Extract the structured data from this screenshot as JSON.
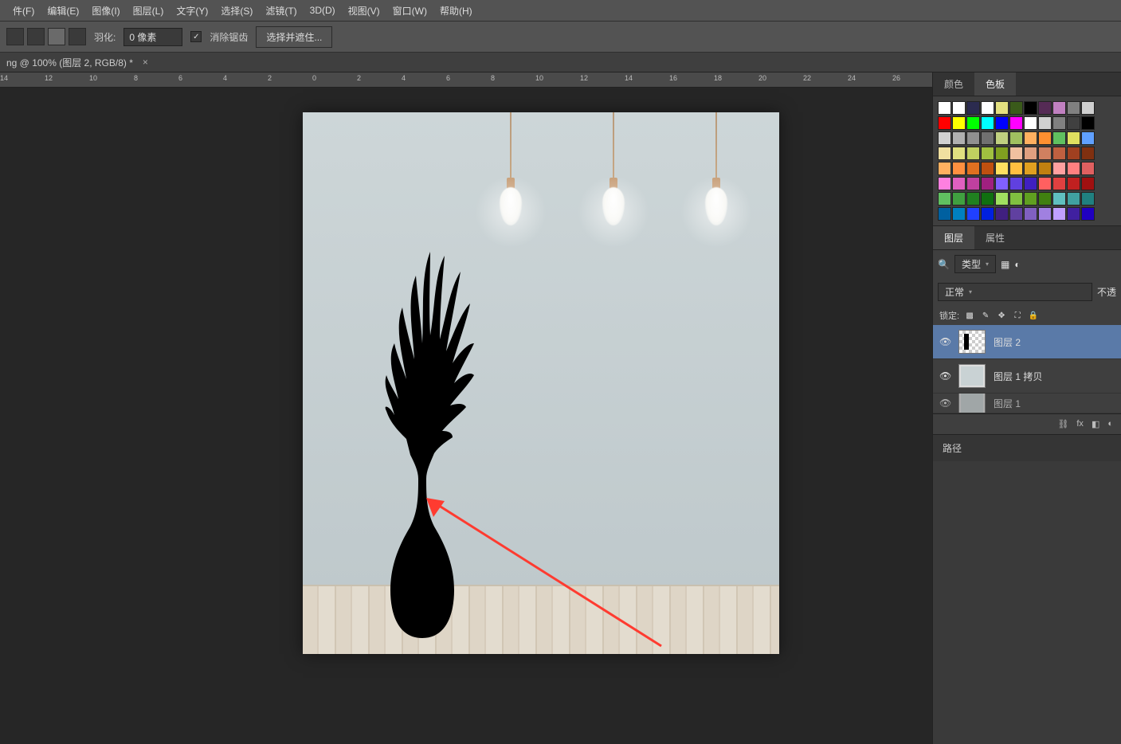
{
  "menu": {
    "file": "件(F)",
    "edit": "编辑(E)",
    "image": "图像(I)",
    "layer": "图层(L)",
    "text": "文字(Y)",
    "select": "选择(S)",
    "filter": "滤镜(T)",
    "3d": "3D(D)",
    "view": "视图(V)",
    "window": "窗口(W)",
    "help": "帮助(H)"
  },
  "options": {
    "feather_label": "羽化:",
    "feather_value": "0 像素",
    "antialias": "消除锯齿",
    "select_mask": "选择并遮住..."
  },
  "doctab": {
    "title": "ng @ 100% (图层 2, RGB/8) *"
  },
  "ruler": [
    "14",
    "12",
    "10",
    "8",
    "6",
    "4",
    "2",
    "0",
    "2",
    "4",
    "6",
    "8",
    "10",
    "12",
    "14",
    "16",
    "18",
    "20",
    "22",
    "24",
    "26"
  ],
  "panels": {
    "color_tab": "颜色",
    "swatch_tab": "色板",
    "layers_tab": "图层",
    "props_tab": "属性",
    "paths_tab": "路径"
  },
  "swatch_rows": [
    [
      "#ffffff",
      "#ffffff",
      "#2b2b4f",
      "#ffffff",
      "#e4e080",
      "#3a5a1a",
      "#000000",
      "#552b55",
      "#c080c0",
      "#808080",
      "#d0d0d0"
    ],
    [
      "#ff0000",
      "#ffff00",
      "#00ff00",
      "#00ffff",
      "#0000ff",
      "#ff00ff",
      "#ffffff",
      "#d0d0d0",
      "#808080",
      "#404040",
      "#000000"
    ],
    [
      "#d0d0d0",
      "#b0b0b0",
      "#909090",
      "#707070",
      "#c0d080",
      "#a0c060",
      "#ffb060",
      "#ff9030",
      "#60c060",
      "#e0e060",
      "#60a0ff"
    ],
    [
      "#f0e0a0",
      "#e0e080",
      "#c0d060",
      "#a0c040",
      "#80a020",
      "#f0c0a0",
      "#e0a080",
      "#d08060",
      "#c06040",
      "#a04020",
      "#803010"
    ],
    [
      "#ffb060",
      "#ff9040",
      "#e07020",
      "#c05010",
      "#ffe060",
      "#ffc040",
      "#e0a020",
      "#c08010",
      "#ffa0a0",
      "#ff8080",
      "#e06060"
    ],
    [
      "#ff80e0",
      "#e060c0",
      "#c040a0",
      "#a02080",
      "#8060ff",
      "#6040e0",
      "#4020c0",
      "#ff6060",
      "#e04040",
      "#c02020",
      "#a01010"
    ],
    [
      "#60c060",
      "#40a040",
      "#208020",
      "#107010",
      "#a0e060",
      "#80c040",
      "#60a020",
      "#408010",
      "#60c0c0",
      "#40a0a0",
      "#208080"
    ],
    [
      "#0060a0",
      "#0080c0",
      "#2040ff",
      "#0020e0",
      "#402080",
      "#6040a0",
      "#8060c0",
      "#a080e0",
      "#c0a0ff",
      "#4020a0",
      "#2000c0"
    ]
  ],
  "layerpanel": {
    "kind_label": "类型",
    "blend": "正常",
    "opacity_partial": "不透",
    "lock_label": "锁定:",
    "layers": [
      {
        "name": "图层 2",
        "selected": true,
        "thumb": "trans"
      },
      {
        "name": "图层 1 拷贝",
        "selected": false,
        "thumb": "img"
      },
      {
        "name": "图层 1",
        "selected": false,
        "thumb": "img",
        "partial": true
      }
    ],
    "foot_fx": "fx"
  }
}
